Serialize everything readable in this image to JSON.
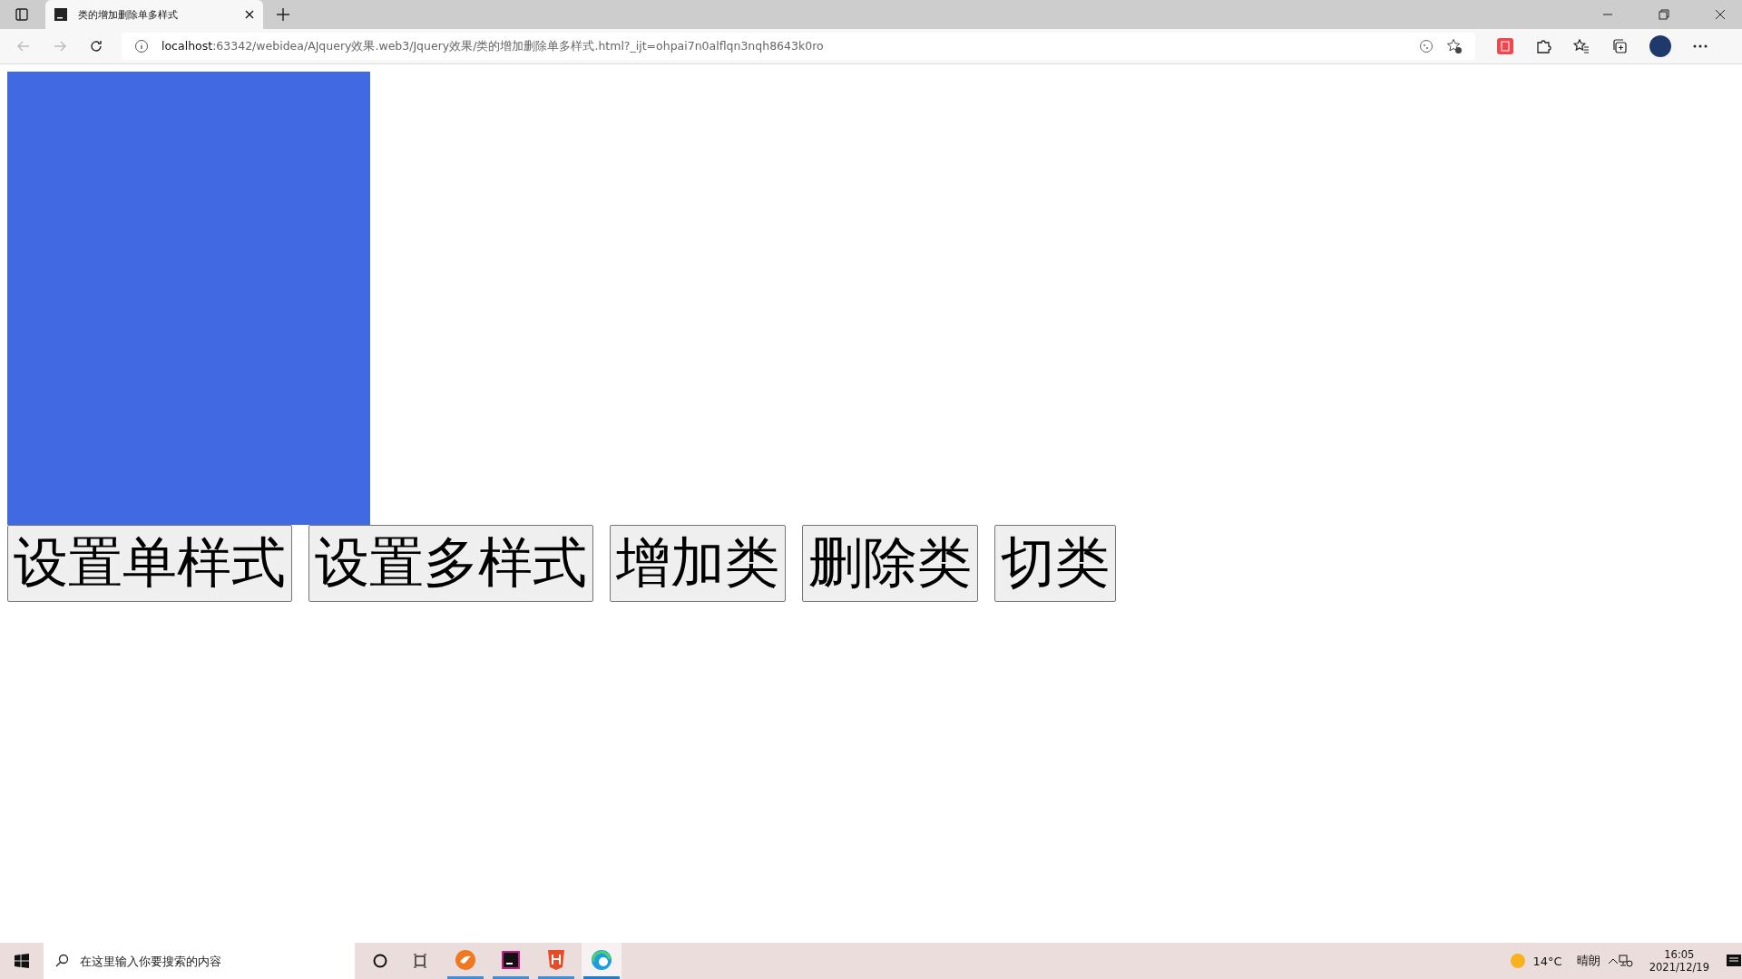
{
  "browser": {
    "tab": {
      "title": "类的增加删除单多样式",
      "selected": true
    },
    "address": {
      "host": "localhost",
      "rest": ":63342/webidea/AJquery效果.web3/Jquery效果/类的增加删除单多样式.html?_ijt=ohpai7n0alflqn3nqh8643k0ro"
    }
  },
  "page": {
    "buttons": [
      "设置单样式",
      "设置多样式",
      "增加类",
      "删除类",
      "切类"
    ]
  },
  "taskbar": {
    "search": {
      "placeholder": "在这里输入你要搜索的内容"
    },
    "apps": [
      {
        "kind": "fox",
        "selected": false
      },
      {
        "kind": "ij",
        "selected": false
      },
      {
        "kind": "html",
        "selected": false
      },
      {
        "kind": "edge",
        "selected": true
      }
    ],
    "weather": {
      "temp": "14°C",
      "condition": "晴朗"
    },
    "time": "16:05",
    "date": "2021/12/19"
  }
}
